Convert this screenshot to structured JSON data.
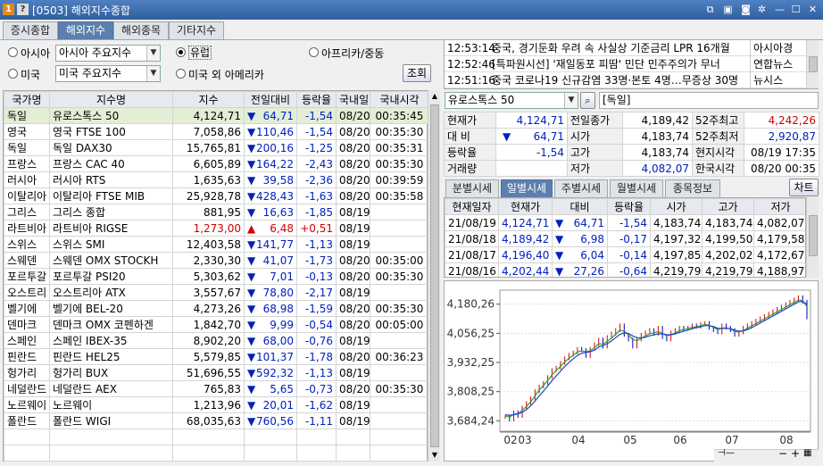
{
  "window": {
    "number": "1",
    "help": "?",
    "title": "[0503] 해외지수종합"
  },
  "tabs": [
    "증시종합",
    "해외지수",
    "해외종목",
    "기타지수"
  ],
  "active_tab": 1,
  "regions": {
    "asia": {
      "label": "아시아",
      "value": "아시아 주요지수"
    },
    "europe": {
      "label": "유럽"
    },
    "africa": {
      "label": "아프리카/중동"
    },
    "usa": {
      "label": "미국",
      "value": "미국 주요지수"
    },
    "other_america": {
      "label": "미국 외 아메리카"
    },
    "query_btn": "조회"
  },
  "index_table": {
    "headers": [
      "국가명",
      "지수명",
      "지수",
      "전일대비",
      "등락율",
      "국내일",
      "국내시각"
    ],
    "rows": [
      {
        "country": "독일",
        "name": "유로스톡스 50",
        "value": "4,124,71",
        "arrow": "▼",
        "change": "64,71",
        "rate": "-1,54",
        "date": "08/20",
        "time": "00:35:45",
        "dir": "down"
      },
      {
        "country": "영국",
        "name": "영국 FTSE 100",
        "value": "7,058,86",
        "arrow": "▼",
        "change": "110,46",
        "rate": "-1,54",
        "date": "08/20",
        "time": "00:35:30",
        "dir": "down"
      },
      {
        "country": "독일",
        "name": "독일 DAX30",
        "value": "15,765,81",
        "arrow": "▼",
        "change": "200,16",
        "rate": "-1,25",
        "date": "08/20",
        "time": "00:35:31",
        "dir": "down"
      },
      {
        "country": "프랑스",
        "name": "프랑스 CAC 40",
        "value": "6,605,89",
        "arrow": "▼",
        "change": "164,22",
        "rate": "-2,43",
        "date": "08/20",
        "time": "00:35:30",
        "dir": "down"
      },
      {
        "country": "러시아",
        "name": "러시아 RTS",
        "value": "1,635,63",
        "arrow": "▼",
        "change": "39,58",
        "rate": "-2,36",
        "date": "08/20",
        "time": "00:39:59",
        "dir": "down"
      },
      {
        "country": "이탈리아",
        "name": "이탈리아 FTSE MIB",
        "value": "25,928,78",
        "arrow": "▼",
        "change": "428,43",
        "rate": "-1,63",
        "date": "08/20",
        "time": "00:35:58",
        "dir": "down"
      },
      {
        "country": "그리스",
        "name": "그리스 종합",
        "value": "881,95",
        "arrow": "▼",
        "change": "16,63",
        "rate": "-1,85",
        "date": "08/19",
        "time": "",
        "dir": "down"
      },
      {
        "country": "라트비아",
        "name": "라트비아 RIGSE",
        "value": "1,273,00",
        "arrow": "▲",
        "change": "6,48",
        "rate": "+0,51",
        "date": "08/19",
        "time": "",
        "dir": "up"
      },
      {
        "country": "스위스",
        "name": "스위스 SMI",
        "value": "12,403,58",
        "arrow": "▼",
        "change": "141,77",
        "rate": "-1,13",
        "date": "08/19",
        "time": "",
        "dir": "down"
      },
      {
        "country": "스웨덴",
        "name": "스웨덴 OMX STOCKH",
        "value": "2,330,30",
        "arrow": "▼",
        "change": "41,07",
        "rate": "-1,73",
        "date": "08/20",
        "time": "00:35:00",
        "dir": "down"
      },
      {
        "country": "포르투갈",
        "name": "포르투갈 PSI20",
        "value": "5,303,62",
        "arrow": "▼",
        "change": "7,01",
        "rate": "-0,13",
        "date": "08/20",
        "time": "00:35:30",
        "dir": "down"
      },
      {
        "country": "오스트리",
        "name": "오스트리아 ATX",
        "value": "3,557,67",
        "arrow": "▼",
        "change": "78,80",
        "rate": "-2,17",
        "date": "08/19",
        "time": "",
        "dir": "down"
      },
      {
        "country": "벨기에",
        "name": "벨기에 BEL-20",
        "value": "4,273,26",
        "arrow": "▼",
        "change": "68,98",
        "rate": "-1,59",
        "date": "08/20",
        "time": "00:35:30",
        "dir": "down"
      },
      {
        "country": "덴마크",
        "name": "덴마크 OMX 코펜하겐",
        "value": "1,842,70",
        "arrow": "▼",
        "change": "9,99",
        "rate": "-0,54",
        "date": "08/20",
        "time": "00:05:00",
        "dir": "down"
      },
      {
        "country": "스페인",
        "name": "스페인 IBEX-35",
        "value": "8,902,20",
        "arrow": "▼",
        "change": "68,00",
        "rate": "-0,76",
        "date": "08/19",
        "time": "",
        "dir": "down"
      },
      {
        "country": "핀란드",
        "name": "핀란드 HEL25",
        "value": "5,579,85",
        "arrow": "▼",
        "change": "101,37",
        "rate": "-1,78",
        "date": "08/20",
        "time": "00:36:23",
        "dir": "down"
      },
      {
        "country": "헝가리",
        "name": "헝가리 BUX",
        "value": "51,696,55",
        "arrow": "▼",
        "change": "592,32",
        "rate": "-1,13",
        "date": "08/19",
        "time": "",
        "dir": "down"
      },
      {
        "country": "네덜란드",
        "name": "네덜란드 AEX",
        "value": "765,83",
        "arrow": "▼",
        "change": "5,65",
        "rate": "-0,73",
        "date": "08/20",
        "time": "00:35:30",
        "dir": "down"
      },
      {
        "country": "노르웨이",
        "name": "노르웨이",
        "value": "1,213,96",
        "arrow": "▼",
        "change": "20,01",
        "rate": "-1,62",
        "date": "08/19",
        "time": "",
        "dir": "down"
      },
      {
        "country": "폴란드",
        "name": "폴란드 WIGI",
        "value": "68,035,63",
        "arrow": "▼",
        "change": "760,56",
        "rate": "-1,11",
        "date": "08/19",
        "time": "",
        "dir": "down"
      }
    ]
  },
  "news": [
    {
      "time": "12:53:14",
      "headline": "중국, 경기둔화 우려 속 사실상 기준금리 LPR 16개월",
      "source": "아시아경"
    },
    {
      "time": "12:52:46",
      "headline": "[특파원시선] '재일동포 피땀' 민단 민주주의가 무너",
      "source": "연합뉴스"
    },
    {
      "time": "12:51:16",
      "headline": "중국 코로나19 신규감염 33명·본토 4명…무증상 30명",
      "source": "뉴시스"
    }
  ],
  "search": {
    "value": "유로스톡스 50",
    "country": "[독일]"
  },
  "quote": {
    "current_label": "현재가",
    "current": "4,124,71",
    "prev_close_label": "전일종가",
    "prev_close": "4,189,42",
    "high52_label": "52주최고",
    "high52": "4,242,26",
    "diff_label": "대 비",
    "diff_arrow": "▼",
    "diff": "64,71",
    "open_label": "시가",
    "open": "4,183,74",
    "low52_label": "52주최저",
    "low52": "2,920,87",
    "rate_label": "등락율",
    "rate": "-1,54",
    "high_label": "고가",
    "high": "4,183,74",
    "local_time_label": "현지시각",
    "local_time": "08/19 17:35",
    "volume_label": "거래량",
    "volume": "",
    "low_label": "저가",
    "low": "4,082,07",
    "kr_time_label": "한국시각",
    "kr_time": "08/20 00:35"
  },
  "sub_tabs": [
    "분별시세",
    "일별시세",
    "주별시세",
    "월별시세",
    "종목정보"
  ],
  "active_sub_tab": 1,
  "chart_btn": "차트",
  "daily": {
    "headers": [
      "현재일자",
      "현재가",
      "대비",
      "등락율",
      "시가",
      "고가",
      "저가"
    ],
    "rows": [
      {
        "date": "21/08/19",
        "price": "4,124,71",
        "arrow": "▼",
        "diff": "64,71",
        "rate": "-1,54",
        "open": "4,183,74",
        "high": "4,183,74",
        "low": "4,082,07"
      },
      {
        "date": "21/08/18",
        "price": "4,189,42",
        "arrow": "▼",
        "diff": "6,98",
        "rate": "-0,17",
        "open": "4,197,32",
        "high": "4,199,50",
        "low": "4,179,58"
      },
      {
        "date": "21/08/17",
        "price": "4,196,40",
        "arrow": "▼",
        "diff": "6,04",
        "rate": "-0,14",
        "open": "4,197,85",
        "high": "4,202,02",
        "low": "4,172,67"
      },
      {
        "date": "21/08/16",
        "price": "4,202,44",
        "arrow": "▼",
        "diff": "27,26",
        "rate": "-0,64",
        "open": "4,219,79",
        "high": "4,219,79",
        "low": "4,188,97"
      }
    ]
  },
  "chart_data": {
    "type": "line",
    "yticks": [
      "4,180,26",
      "4,056,25",
      "3,932,25",
      "3,808,25",
      "3,684,24"
    ],
    "xticks": [
      "02",
      "03",
      "04",
      "05",
      "06",
      "07",
      "08"
    ],
    "ylim": [
      3640,
      4240
    ],
    "series": [
      {
        "values": [
          3700,
          3690,
          3720,
          3705,
          3740,
          3760,
          3780,
          3810,
          3830,
          3845,
          3870,
          3900,
          3910,
          3930,
          3950,
          3965,
          3975,
          3990,
          3985,
          3960,
          3990,
          4010,
          4030,
          4000,
          4040,
          4055,
          4070,
          4090,
          4050,
          4030,
          4000,
          4030,
          4050,
          4060,
          4070,
          4055,
          4080,
          4040,
          4030,
          4060,
          4070,
          4080,
          4075,
          4080,
          4090,
          4085,
          4095,
          4100,
          4080,
          4070,
          4060,
          4090,
          4080,
          4070,
          4050,
          4060,
          4080,
          4090,
          4100,
          4110,
          4120,
          4130,
          4140,
          4150,
          4160,
          4170,
          4180,
          4190,
          4200,
          4210,
          4190,
          4124
        ]
      },
      {
        "values": [
          3705,
          3700,
          3712,
          3715,
          3728,
          3745,
          3765,
          3790,
          3815,
          3835,
          3855,
          3880,
          3898,
          3915,
          3935,
          3950,
          3963,
          3977,
          3982,
          3978,
          3982,
          3995,
          4012,
          4010,
          4022,
          4036,
          4052,
          4070,
          4065,
          4050,
          4030,
          4025,
          4035,
          4045,
          4055,
          4058,
          4064,
          4056,
          4046,
          4050,
          4058,
          4068,
          4072,
          4076,
          4082,
          4084,
          4089,
          4095,
          4090,
          4082,
          4072,
          4078,
          4080,
          4075,
          4064,
          4062,
          4068,
          4078,
          4088,
          4098,
          4108,
          4118,
          4128,
          4138,
          4148,
          4158,
          4168,
          4178,
          4188,
          4198,
          4195,
          4170
        ]
      },
      {
        "values": [
          3710,
          3708,
          3710,
          3714,
          3720,
          3732,
          3748,
          3768,
          3790,
          3810,
          3832,
          3855,
          3875,
          3895,
          3915,
          3932,
          3948,
          3962,
          3972,
          3975,
          3978,
          3985,
          3998,
          4004,
          4012,
          4024,
          4038,
          4052,
          4058,
          4055,
          4045,
          4038,
          4036,
          4040,
          4046,
          4050,
          4054,
          4054,
          4050,
          4050,
          4054,
          4060,
          4065,
          4070,
          4076,
          4080,
          4084,
          4089,
          4089,
          4085,
          4078,
          4077,
          4078,
          4076,
          4070,
          4066,
          4066,
          4072,
          4080,
          4090,
          4100,
          4110,
          4120,
          4130,
          4140,
          4150,
          4160,
          4170,
          4180,
          4190,
          4192,
          4180
        ]
      }
    ]
  }
}
